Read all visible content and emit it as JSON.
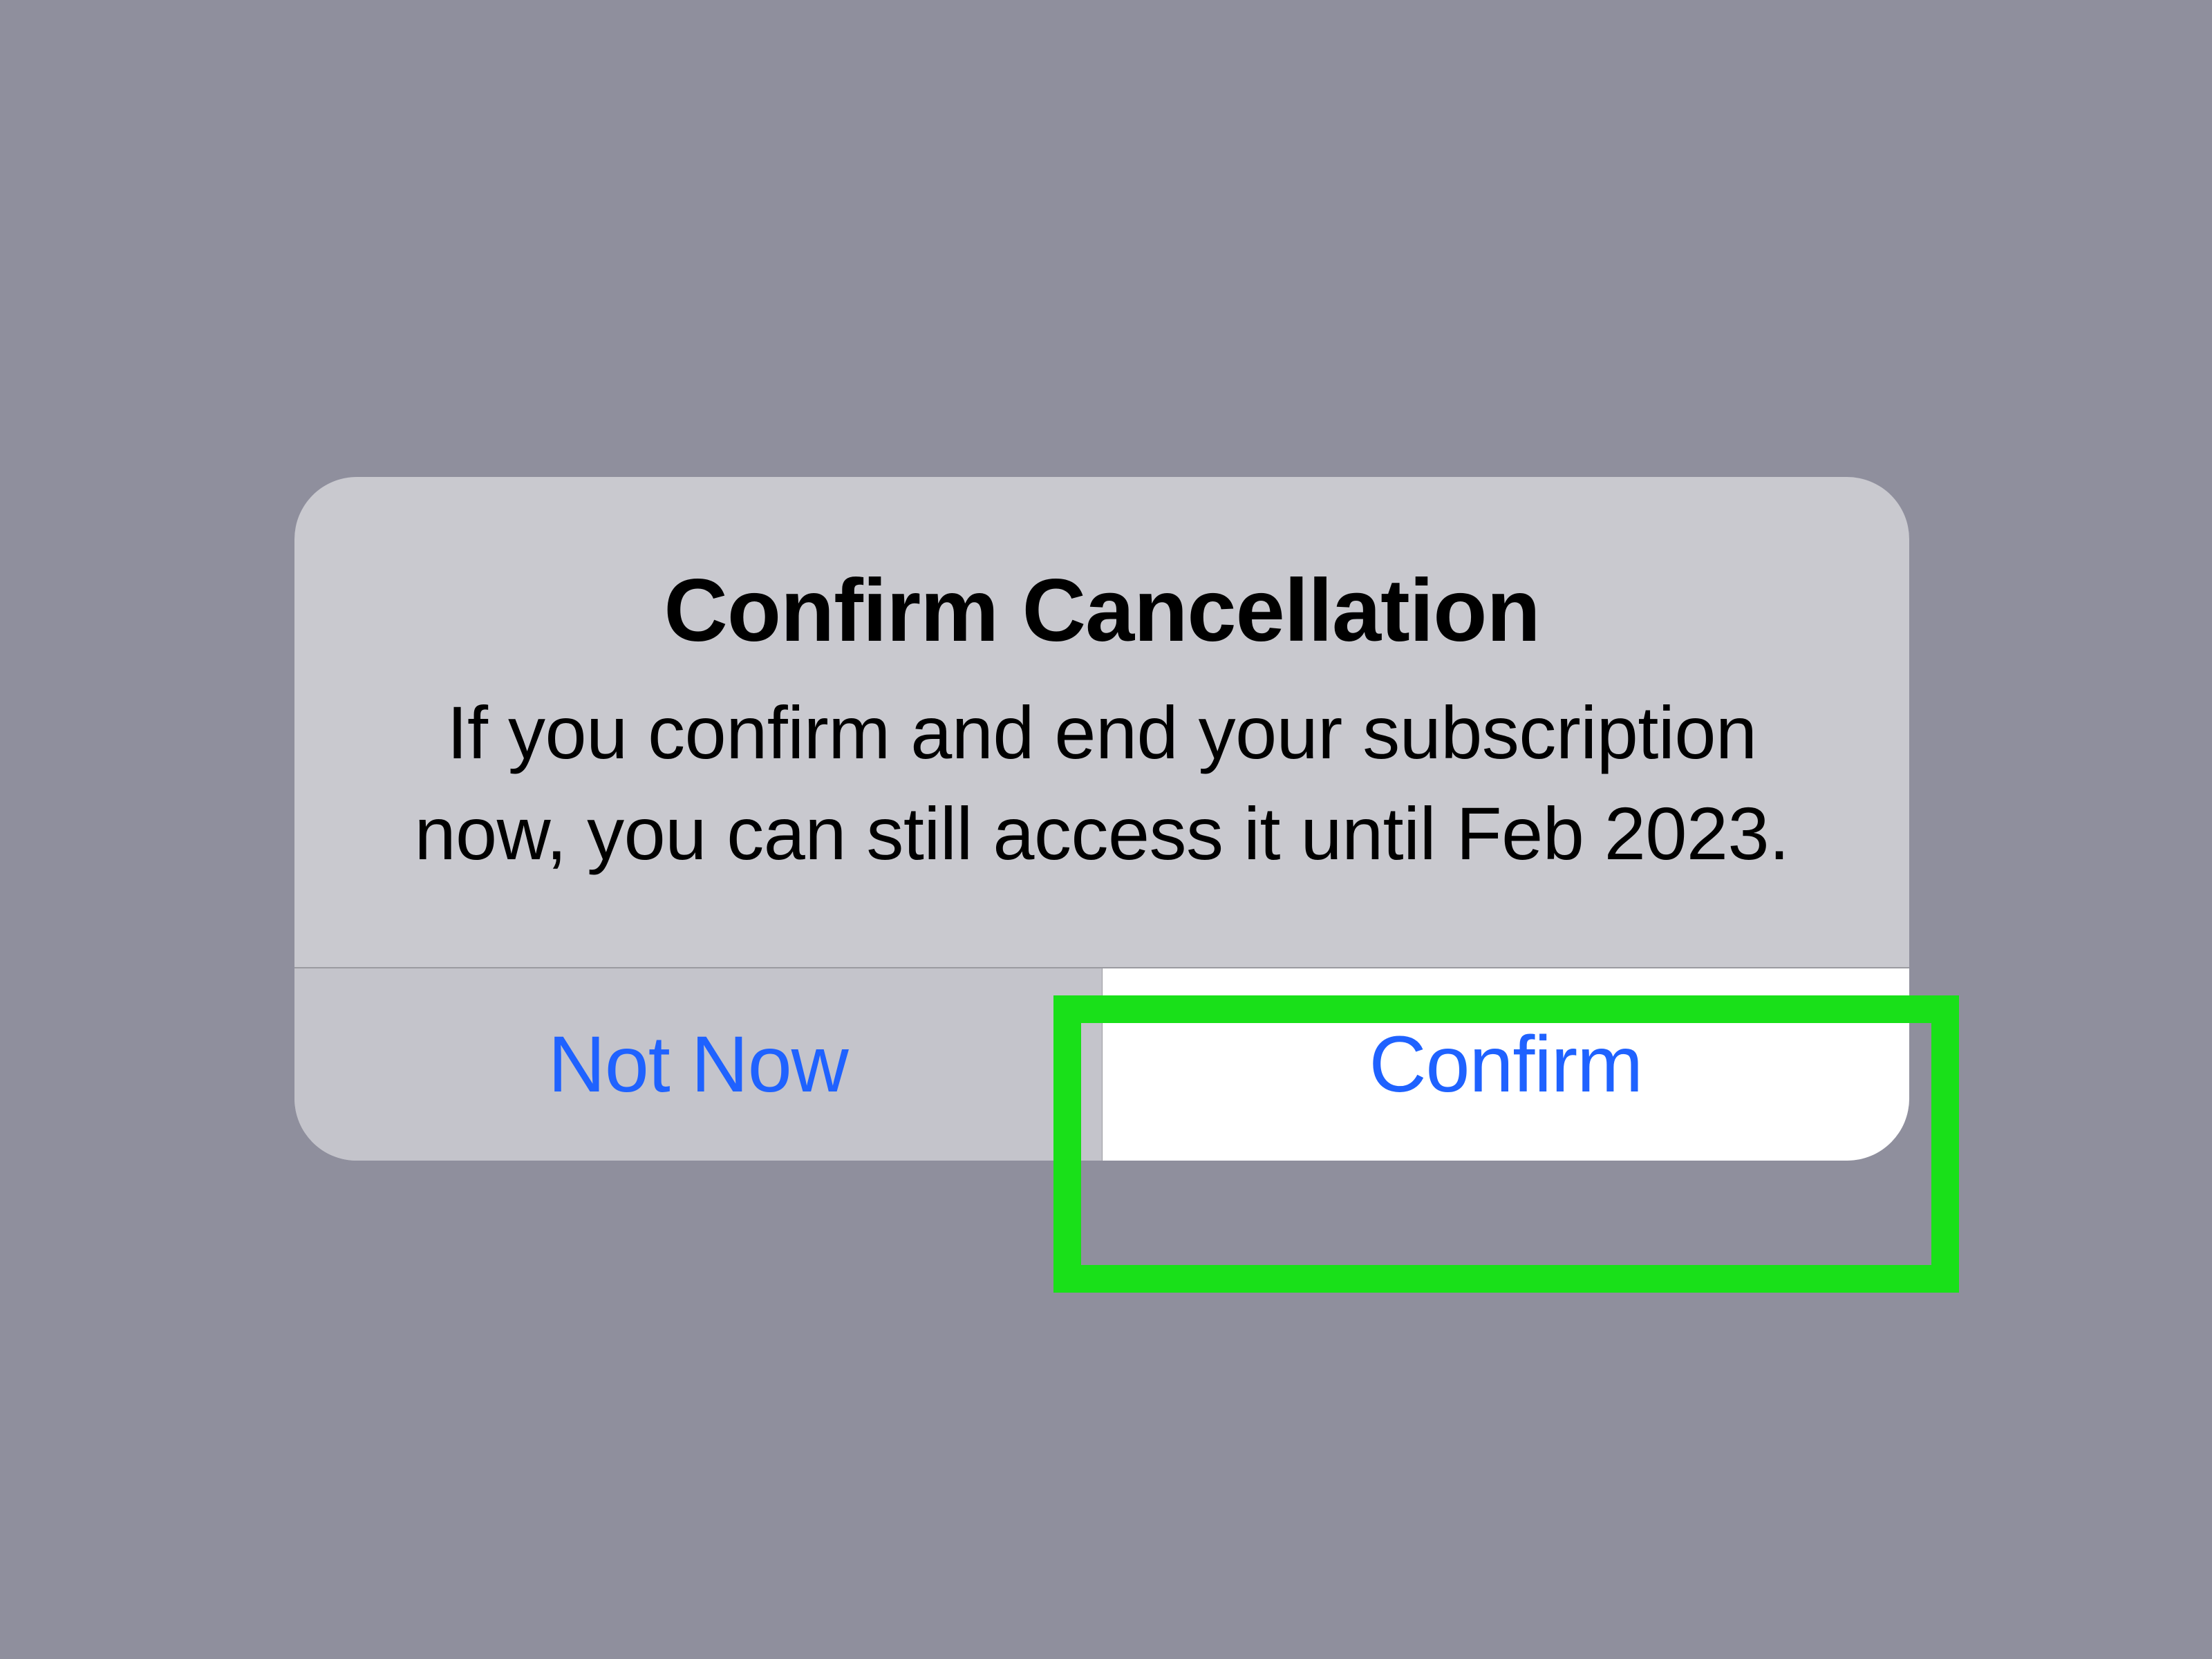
{
  "dialog": {
    "title": "Confirm Cancellation",
    "message": "If you confirm and end your subscription now, you can still access it until Feb 2023.",
    "buttons": {
      "not_now": "Not Now",
      "confirm": "Confirm"
    }
  }
}
